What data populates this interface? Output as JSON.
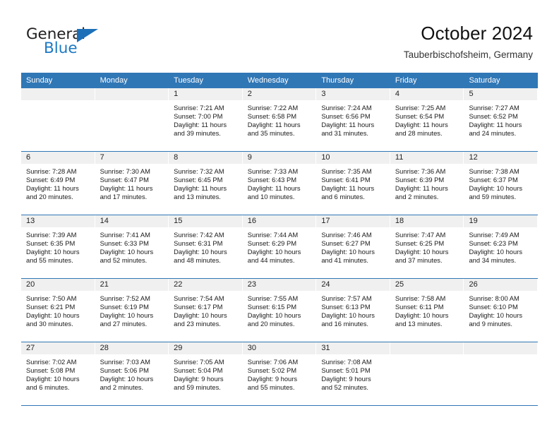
{
  "brand": {
    "name_top": "General",
    "name_bottom": "Blue",
    "triangle_color": "#1d70b8",
    "text_color": "#231f20",
    "blue_color": "#1d79c4"
  },
  "header": {
    "title": "October 2024",
    "subtitle": "Tauberbischofsheim, Germany"
  },
  "theme": {
    "header_blue": "#3077b6",
    "date_band": "#f0f0f0",
    "text": "#1a1a1a"
  },
  "weekdays": [
    "Sunday",
    "Monday",
    "Tuesday",
    "Wednesday",
    "Thursday",
    "Friday",
    "Saturday"
  ],
  "labels": {
    "sunrise_prefix": "Sunrise:",
    "sunset_prefix": "Sunset:",
    "daylight_prefix": "Daylight:"
  },
  "weeks": [
    [
      {
        "day": "",
        "lines": []
      },
      {
        "day": "",
        "lines": []
      },
      {
        "day": "1",
        "lines": [
          "Sunrise: 7:21 AM",
          "Sunset: 7:00 PM",
          "Daylight: 11 hours",
          "and 39 minutes."
        ]
      },
      {
        "day": "2",
        "lines": [
          "Sunrise: 7:22 AM",
          "Sunset: 6:58 PM",
          "Daylight: 11 hours",
          "and 35 minutes."
        ]
      },
      {
        "day": "3",
        "lines": [
          "Sunrise: 7:24 AM",
          "Sunset: 6:56 PM",
          "Daylight: 11 hours",
          "and 31 minutes."
        ]
      },
      {
        "day": "4",
        "lines": [
          "Sunrise: 7:25 AM",
          "Sunset: 6:54 PM",
          "Daylight: 11 hours",
          "and 28 minutes."
        ]
      },
      {
        "day": "5",
        "lines": [
          "Sunrise: 7:27 AM",
          "Sunset: 6:52 PM",
          "Daylight: 11 hours",
          "and 24 minutes."
        ]
      }
    ],
    [
      {
        "day": "6",
        "lines": [
          "Sunrise: 7:28 AM",
          "Sunset: 6:49 PM",
          "Daylight: 11 hours",
          "and 20 minutes."
        ]
      },
      {
        "day": "7",
        "lines": [
          "Sunrise: 7:30 AM",
          "Sunset: 6:47 PM",
          "Daylight: 11 hours",
          "and 17 minutes."
        ]
      },
      {
        "day": "8",
        "lines": [
          "Sunrise: 7:32 AM",
          "Sunset: 6:45 PM",
          "Daylight: 11 hours",
          "and 13 minutes."
        ]
      },
      {
        "day": "9",
        "lines": [
          "Sunrise: 7:33 AM",
          "Sunset: 6:43 PM",
          "Daylight: 11 hours",
          "and 10 minutes."
        ]
      },
      {
        "day": "10",
        "lines": [
          "Sunrise: 7:35 AM",
          "Sunset: 6:41 PM",
          "Daylight: 11 hours",
          "and 6 minutes."
        ]
      },
      {
        "day": "11",
        "lines": [
          "Sunrise: 7:36 AM",
          "Sunset: 6:39 PM",
          "Daylight: 11 hours",
          "and 2 minutes."
        ]
      },
      {
        "day": "12",
        "lines": [
          "Sunrise: 7:38 AM",
          "Sunset: 6:37 PM",
          "Daylight: 10 hours",
          "and 59 minutes."
        ]
      }
    ],
    [
      {
        "day": "13",
        "lines": [
          "Sunrise: 7:39 AM",
          "Sunset: 6:35 PM",
          "Daylight: 10 hours",
          "and 55 minutes."
        ]
      },
      {
        "day": "14",
        "lines": [
          "Sunrise: 7:41 AM",
          "Sunset: 6:33 PM",
          "Daylight: 10 hours",
          "and 52 minutes."
        ]
      },
      {
        "day": "15",
        "lines": [
          "Sunrise: 7:42 AM",
          "Sunset: 6:31 PM",
          "Daylight: 10 hours",
          "and 48 minutes."
        ]
      },
      {
        "day": "16",
        "lines": [
          "Sunrise: 7:44 AM",
          "Sunset: 6:29 PM",
          "Daylight: 10 hours",
          "and 44 minutes."
        ]
      },
      {
        "day": "17",
        "lines": [
          "Sunrise: 7:46 AM",
          "Sunset: 6:27 PM",
          "Daylight: 10 hours",
          "and 41 minutes."
        ]
      },
      {
        "day": "18",
        "lines": [
          "Sunrise: 7:47 AM",
          "Sunset: 6:25 PM",
          "Daylight: 10 hours",
          "and 37 minutes."
        ]
      },
      {
        "day": "19",
        "lines": [
          "Sunrise: 7:49 AM",
          "Sunset: 6:23 PM",
          "Daylight: 10 hours",
          "and 34 minutes."
        ]
      }
    ],
    [
      {
        "day": "20",
        "lines": [
          "Sunrise: 7:50 AM",
          "Sunset: 6:21 PM",
          "Daylight: 10 hours",
          "and 30 minutes."
        ]
      },
      {
        "day": "21",
        "lines": [
          "Sunrise: 7:52 AM",
          "Sunset: 6:19 PM",
          "Daylight: 10 hours",
          "and 27 minutes."
        ]
      },
      {
        "day": "22",
        "lines": [
          "Sunrise: 7:54 AM",
          "Sunset: 6:17 PM",
          "Daylight: 10 hours",
          "and 23 minutes."
        ]
      },
      {
        "day": "23",
        "lines": [
          "Sunrise: 7:55 AM",
          "Sunset: 6:15 PM",
          "Daylight: 10 hours",
          "and 20 minutes."
        ]
      },
      {
        "day": "24",
        "lines": [
          "Sunrise: 7:57 AM",
          "Sunset: 6:13 PM",
          "Daylight: 10 hours",
          "and 16 minutes."
        ]
      },
      {
        "day": "25",
        "lines": [
          "Sunrise: 7:58 AM",
          "Sunset: 6:11 PM",
          "Daylight: 10 hours",
          "and 13 minutes."
        ]
      },
      {
        "day": "26",
        "lines": [
          "Sunrise: 8:00 AM",
          "Sunset: 6:10 PM",
          "Daylight: 10 hours",
          "and 9 minutes."
        ]
      }
    ],
    [
      {
        "day": "27",
        "lines": [
          "Sunrise: 7:02 AM",
          "Sunset: 5:08 PM",
          "Daylight: 10 hours",
          "and 6 minutes."
        ]
      },
      {
        "day": "28",
        "lines": [
          "Sunrise: 7:03 AM",
          "Sunset: 5:06 PM",
          "Daylight: 10 hours",
          "and 2 minutes."
        ]
      },
      {
        "day": "29",
        "lines": [
          "Sunrise: 7:05 AM",
          "Sunset: 5:04 PM",
          "Daylight: 9 hours",
          "and 59 minutes."
        ]
      },
      {
        "day": "30",
        "lines": [
          "Sunrise: 7:06 AM",
          "Sunset: 5:02 PM",
          "Daylight: 9 hours",
          "and 55 minutes."
        ]
      },
      {
        "day": "31",
        "lines": [
          "Sunrise: 7:08 AM",
          "Sunset: 5:01 PM",
          "Daylight: 9 hours",
          "and 52 minutes."
        ]
      },
      {
        "day": "",
        "lines": []
      },
      {
        "day": "",
        "lines": []
      }
    ]
  ]
}
